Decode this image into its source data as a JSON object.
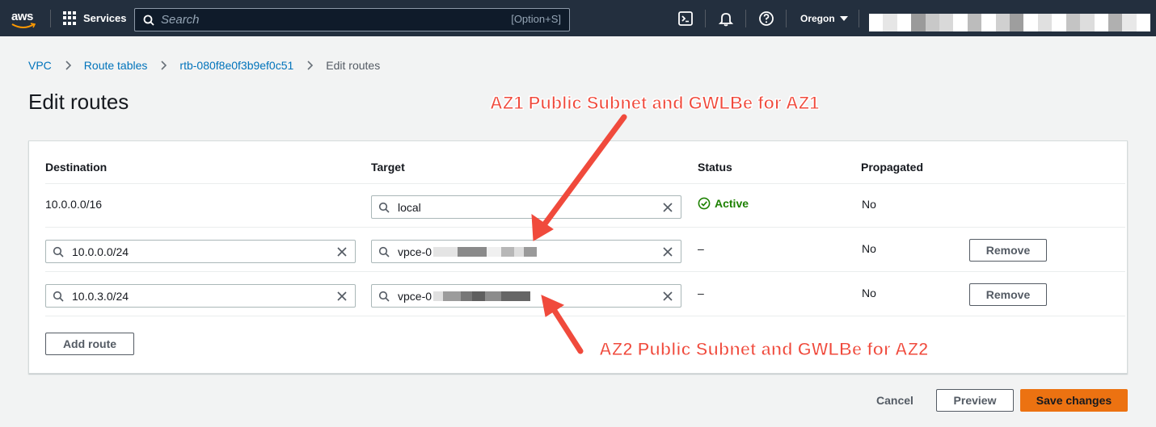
{
  "nav": {
    "logo_text": "aws",
    "services_label": "Services",
    "search_placeholder": "Search",
    "search_shortcut": "[Option+S]",
    "region": "Oregon",
    "account_blur_colors": [
      "#ffffff",
      "#e6e6e6",
      "#ffffff",
      "#9a9a9a",
      "#c8c8c8",
      "#d9d9d9",
      "#ffffff",
      "#bcbcbc",
      "#ffffff",
      "#d0d0d0",
      "#9e9e9e",
      "#ffffff",
      "#e0e0e0",
      "#ffffff",
      "#c4c4c4",
      "#dddddd",
      "#ffffff",
      "#b0b0b0",
      "#e8e8e8",
      "#ffffff"
    ]
  },
  "breadcrumb": {
    "items": [
      "VPC",
      "Route tables",
      "rtb-080f8e0f3b9ef0c51"
    ],
    "current": "Edit routes"
  },
  "page": {
    "title": "Edit routes"
  },
  "table": {
    "headers": {
      "destination": "Destination",
      "target": "Target",
      "status": "Status",
      "propagated": "Propagated"
    },
    "rows": [
      {
        "destination": "10.0.0.0/16",
        "target": "local",
        "status": "Active",
        "propagated": "No"
      },
      {
        "destination": "10.0.0.0/24",
        "target": "vpce-0",
        "status": "–",
        "propagated": "No",
        "remove_label": "Remove"
      },
      {
        "destination": "10.0.3.0/24",
        "target": "vpce-0",
        "status": "–",
        "propagated": "No",
        "remove_label": "Remove"
      }
    ],
    "add_route_label": "Add route"
  },
  "footer": {
    "cancel_label": "Cancel",
    "preview_label": "Preview",
    "save_label": "Save changes"
  },
  "annotations": {
    "az1": "AZ1 Public Subnet and GWLBe for AZ1",
    "az2": "AZ2 Public Subnet and GWLBe for AZ2"
  },
  "colors": {
    "nav_bg": "#232f3e",
    "link": "#0073bb",
    "primary": "#ec7211",
    "status_active": "#1d8102",
    "annotation": "#f04a3c"
  }
}
